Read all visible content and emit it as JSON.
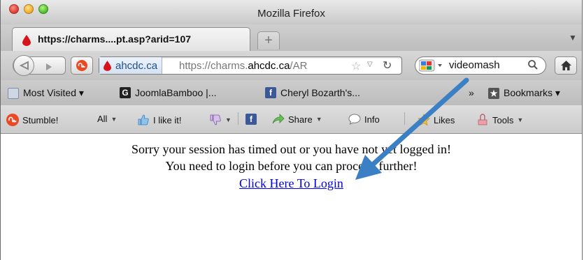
{
  "window": {
    "title": "Mozilla Firefox"
  },
  "tabs": [
    {
      "title": "https://charms....pt.asp?arid=107",
      "active": true
    }
  ],
  "new_tab_label": "+",
  "navbar": {
    "identity_label": "ahcdc.ca",
    "url_prefix": "https://charms.",
    "url_host": "ahcdc.ca",
    "url_suffix": "/AR",
    "search_value": "videomash"
  },
  "bookmarks_bar": {
    "items": [
      {
        "label": "Most Visited ▾",
        "icon": "smart-folder-icon"
      },
      {
        "label": "JoomlaBamboo |...",
        "icon": "joomlabamboo-favicon"
      },
      {
        "label": "Cheryl Bozarth's...",
        "icon": "facebook-icon"
      }
    ],
    "overflow_label": "»",
    "bookmarks_menu_label": "Bookmarks ▾"
  },
  "stumble_toolbar": {
    "stumble_label": "Stumble!",
    "all_label": "All",
    "like_label": "I like it!",
    "share_label": "Share",
    "info_label": "Info",
    "likes_label": "Likes",
    "tools_label": "Tools"
  },
  "page": {
    "message_line1": "Sorry your session has timed out or you have not yet logged in!",
    "message_line2": "You need to login before you can proceed further!",
    "login_link": "Click Here To Login"
  },
  "colors": {
    "annotation_arrow": "#3b7fc4",
    "link": "#0000ee",
    "stumbleupon": "#eb4924"
  }
}
